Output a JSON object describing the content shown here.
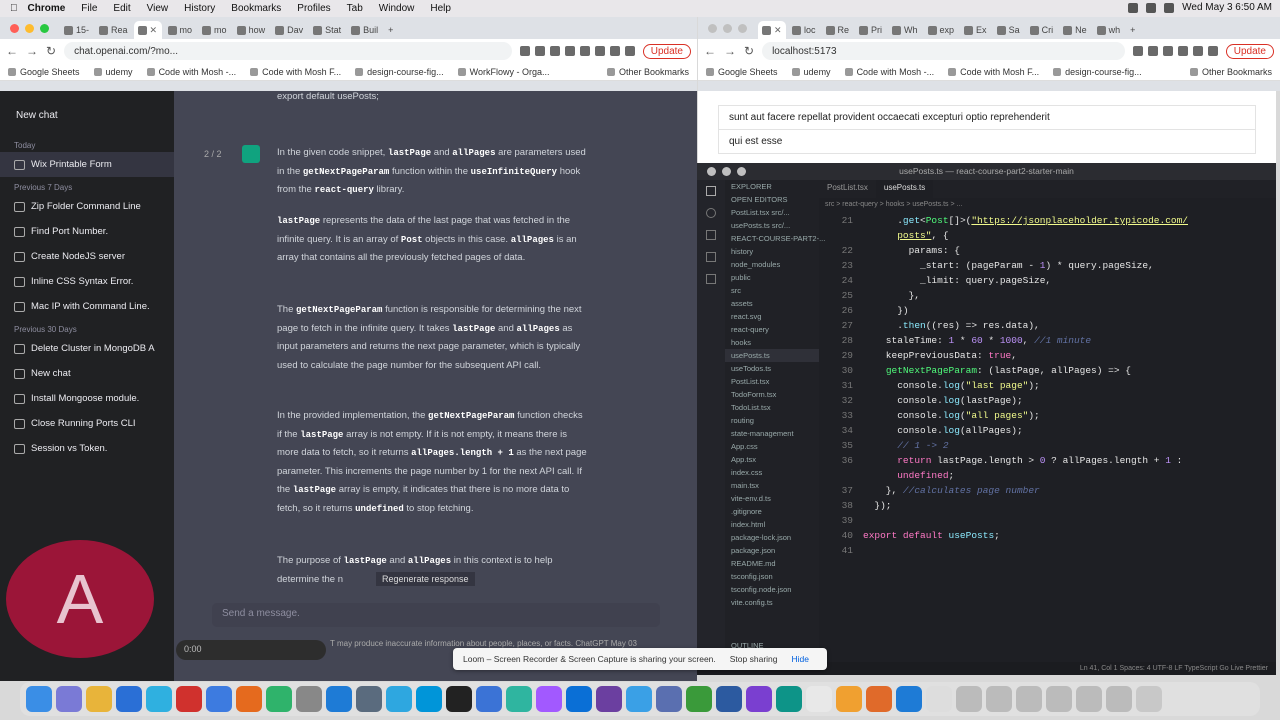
{
  "menubar": {
    "app": "Chrome",
    "items": [
      "File",
      "Edit",
      "View",
      "History",
      "Bookmarks",
      "Profiles",
      "Tab",
      "Window",
      "Help"
    ],
    "datetime": "Wed May 3  6:50 AM"
  },
  "left_browser": {
    "url": "chat.openai.com/?mo...",
    "update": "Update",
    "bookmarks": [
      "Google Sheets",
      "udemy",
      "Code with Mosh -...",
      "Code with Mosh F...",
      "design-course-fig...",
      "WorkFlowy - Orga...",
      "Other Bookmarks"
    ],
    "tabs": [
      "15-",
      "Rea",
      "mo",
      "mo",
      "how",
      "Dav",
      "Stat",
      "Buil"
    ]
  },
  "right_browser": {
    "url": "localhost:5173",
    "update": "Update",
    "bookmarks": [
      "Google Sheets",
      "udemy",
      "Code with Mosh -...",
      "Code with Mosh F...",
      "design-course-fig...",
      "Other Bookmarks"
    ],
    "tabs": [
      "loc",
      "Re",
      "Pri",
      "Wh",
      "exp",
      "Ex",
      "Sa",
      "Cri",
      "Ne",
      "wh"
    ],
    "page_rows": [
      "sunt aut facere repellat provident occaecati excepturi optio reprehenderit",
      "qui est esse"
    ]
  },
  "chat_sidebar": {
    "new_chat": "New chat",
    "groups": [
      {
        "label": "Today",
        "items": [
          "Wix Printable Form"
        ]
      },
      {
        "label": "Previous 7 Days",
        "items": [
          "Zip Folder Command Line",
          "Find Port Number.",
          "Create NodeJS server",
          "Inline CSS Syntax Error.",
          "Mac IP with Command Line."
        ]
      },
      {
        "label": "Previous 30 Days",
        "items": [
          "Delete Cluster in MongoDB A",
          "New chat",
          "Install Mongoose module.",
          "Close Running Ports CLI",
          "Session vs Token."
        ]
      }
    ]
  },
  "chat_main": {
    "top_code": "export default usePosts;",
    "counter": "2 / 2",
    "regen": "Regenerate response",
    "send_placeholder": "Send a message.",
    "disclaimer": "T may produce inaccurate information about people, places, or facts. ChatGPT May 03",
    "recorder_time": "0:00",
    "avatar": "A"
  },
  "vscode": {
    "title": "usePosts.ts — react-course-part2-starter-main",
    "tabs": [
      "PostList.tsx",
      "usePosts.ts"
    ],
    "breadcrumb": "src > react-query > hooks > usePosts.ts > ...",
    "explorer": [
      "EXPLORER",
      "OPEN EDITORS",
      "PostList.tsx src/...",
      "usePosts.ts src/...",
      "REACT-COURSE-PART2-...",
      "history",
      "node_modules",
      "public",
      "src",
      "assets",
      "react.svg",
      "react-query",
      "hooks",
      "usePosts.ts",
      "useTodos.ts",
      "PostList.tsx",
      "TodoForm.tsx",
      "TodoList.tsx",
      "routing",
      "state-management",
      "App.css",
      "App.tsx",
      "index.css",
      "main.tsx",
      "vite-env.d.ts",
      ".gitignore",
      "index.html",
      "package-lock.json",
      "package.json",
      "README.md",
      "tsconfig.json",
      "tsconfig.node.json",
      "vite.config.ts",
      "OUTLINE"
    ],
    "line_numbers": [
      "21",
      "22",
      "23",
      "24",
      "25",
      "26",
      "27",
      "28",
      "29",
      "30",
      "31",
      "32",
      "33",
      "34",
      "35",
      "36",
      "",
      "37",
      "38",
      "39",
      "40",
      "41"
    ],
    "status": "Ln 41, Col 1   Spaces: 4   UTF-8   LF   TypeScript   Go Live   Prettier"
  },
  "loom": {
    "text": "Loom – Screen Recorder & Screen Capture is sharing your screen.",
    "stop": "Stop sharing",
    "hide": "Hide"
  }
}
